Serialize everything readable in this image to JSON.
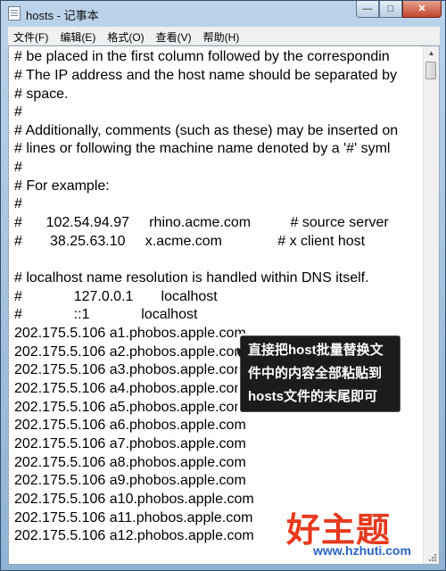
{
  "window": {
    "title": "hosts - 记事本"
  },
  "controls": {
    "minimize": "—",
    "maximize": "□",
    "close": "✕"
  },
  "menu": [
    "文件(F)",
    "编辑(E)",
    "格式(O)",
    "查看(V)",
    "帮助(H)"
  ],
  "lines": [
    "# be placed in the first column followed by the correspondin",
    "# The IP address and the host name should be separated by",
    "# space.",
    "#",
    "# Additionally, comments (such as these) may be inserted on",
    "# lines or following the machine name denoted by a '#' syml",
    "#",
    "# For example:",
    "#",
    "#      102.54.94.97     rhino.acme.com          # source server",
    "#       38.25.63.10     x.acme.com              # x client host",
    "",
    "# localhost name resolution is handled within DNS itself.",
    "#             127.0.0.1       localhost",
    "#             ::1             localhost",
    "202.175.5.106 a1.phobos.apple.com",
    "202.175.5.106 a2.phobos.apple.com",
    "202.175.5.106 a3.phobos.apple.com",
    "202.175.5.106 a4.phobos.apple.com",
    "202.175.5.106 a5.phobos.apple.com",
    "202.175.5.106 a6.phobos.apple.com",
    "202.175.5.106 a7.phobos.apple.com",
    "202.175.5.106 a8.phobos.apple.com",
    "202.175.5.106 a9.phobos.apple.com",
    "202.175.5.106 a10.phobos.apple.com",
    "202.175.5.106 a11.phobos.apple.com",
    "202.175.5.106 a12.phobos.apple.com"
  ],
  "callout": {
    "text": "直接把host批量替换文件中的内容全部粘贴到hosts文件的末尾即可"
  },
  "watermark": {
    "brand": "好主题",
    "url": "www.hzhuti.com"
  },
  "icons": {
    "app": "notepad-icon",
    "scroll_up": "scroll-up-arrow-icon"
  }
}
